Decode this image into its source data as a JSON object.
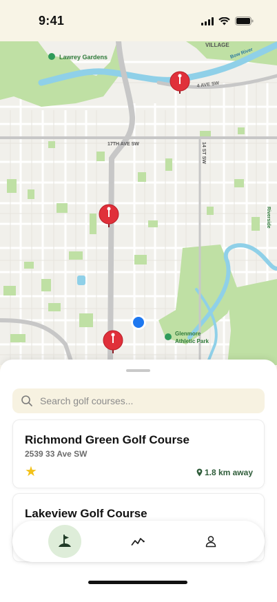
{
  "status_bar": {
    "time": "9:41"
  },
  "map": {
    "labels": {
      "park_north": "Lawrey Gardens",
      "district": "VILLAGE",
      "river": "Bow River",
      "avenue_4": "4 AVE SW",
      "avenue_17": "17TH AVE SW",
      "street_14": "14 ST SW",
      "park_south_1": "Glenmore",
      "park_south_2": "Athletic Park",
      "east_park": "Riverside"
    },
    "colors": {
      "park": "#bfe0a4",
      "water": "#8fd0e8",
      "road": "#c7c7c7",
      "pin": "#e0303a",
      "location": "#1e78f0"
    }
  },
  "search": {
    "placeholder": "Search golf courses..."
  },
  "courses": [
    {
      "name": "Richmond Green Golf Course",
      "address": "2539 33 Ave SW",
      "rating_icon": "★",
      "distance": "1.8 km away"
    },
    {
      "name": "Lakeview Golf Course"
    }
  ],
  "tabbar": {
    "active_tab": "courses",
    "tabs": [
      "courses-flag-icon",
      "stats-icon",
      "profile-icon"
    ]
  }
}
